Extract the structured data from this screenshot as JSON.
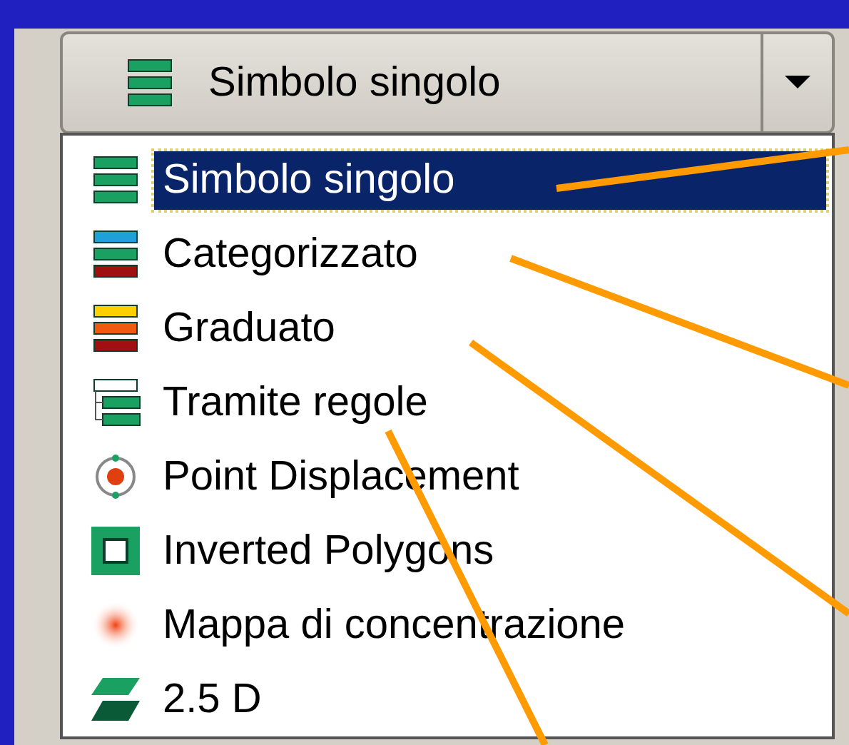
{
  "combo": {
    "value": "Simbolo singolo",
    "kind": "single"
  },
  "options": [
    {
      "label": "Simbolo singolo",
      "kind": "single",
      "selected": true
    },
    {
      "label": "Categorizzato",
      "kind": "categorized",
      "selected": false
    },
    {
      "label": "Graduato",
      "kind": "graduated",
      "selected": false
    },
    {
      "label": "Tramite regole",
      "kind": "rules",
      "selected": false
    },
    {
      "label": "Point Displacement",
      "kind": "displacement",
      "selected": false
    },
    {
      "label": "Inverted Polygons",
      "kind": "inverted",
      "selected": false
    },
    {
      "label": "Mappa di concentrazione",
      "kind": "heatmap",
      "selected": false
    },
    {
      "label": "2.5 D",
      "kind": "twofived",
      "selected": false
    }
  ]
}
